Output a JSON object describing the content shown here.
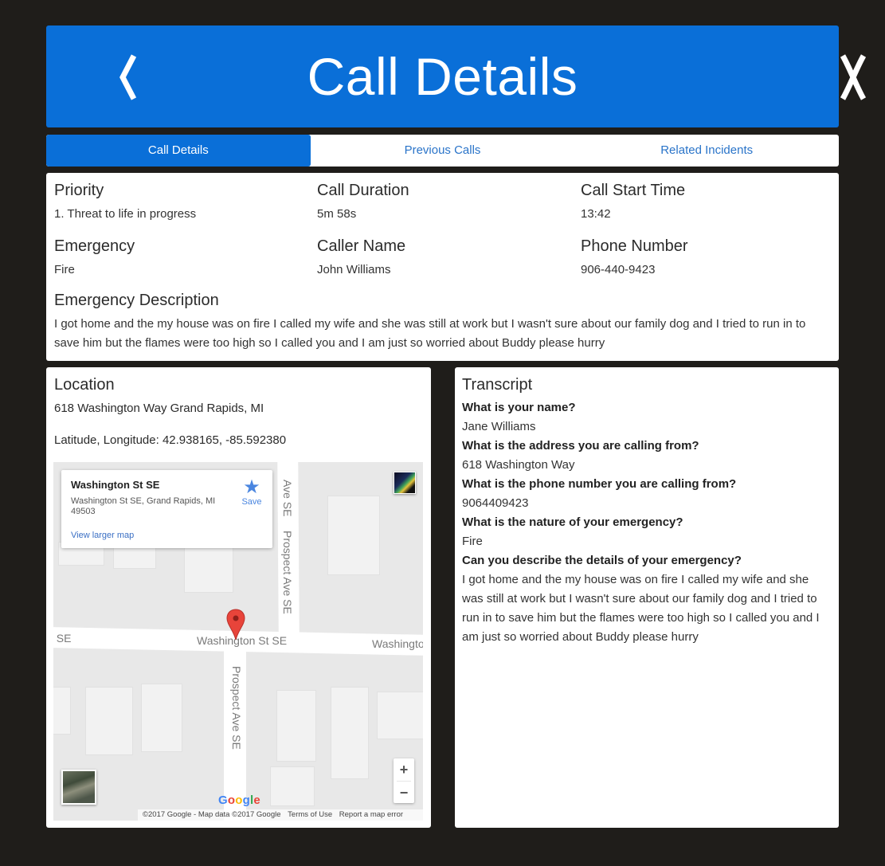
{
  "header": {
    "title": "Call Details",
    "back_icon": "chevron-left-icon",
    "close_icon": "close-icon"
  },
  "tabs": [
    {
      "label": "Call Details",
      "active": true
    },
    {
      "label": "Previous Calls",
      "active": false
    },
    {
      "label": "Related Incidents",
      "active": false
    }
  ],
  "details": {
    "priority": {
      "label": "Priority",
      "value": "1. Threat to life in progress"
    },
    "call_duration": {
      "label": "Call Duration",
      "value": "5m 58s"
    },
    "call_start_time": {
      "label": "Call Start Time",
      "value": "13:42"
    },
    "emergency": {
      "label": "Emergency",
      "value": "Fire"
    },
    "caller_name": {
      "label": "Caller Name",
      "value": "John Williams"
    },
    "phone_number": {
      "label": "Phone Number",
      "value": "906-440-9423"
    },
    "description": {
      "label": "Emergency Description",
      "value": "I got home and the my house was on fire I called my wife and she was still at work but I wasn't sure about our family dog and I tried to run in to save him but the flames were too high so I called you and I am just so worried about Buddy please hurry"
    }
  },
  "location": {
    "label": "Location",
    "address": "618 Washington Way Grand Rapids, MI",
    "coords": "Latitude, Longitude: 42.938165, -85.592380",
    "map": {
      "card_name": "Washington St SE",
      "card_address": "Washington St SE, Grand Rapids, MI 49503",
      "card_link": "View larger map",
      "save_label": "Save",
      "street_main": "Washington St SE",
      "street_left": "t SE",
      "street_right": "Washingto",
      "street_vertical_top": "Prospect Ave SE",
      "street_vertical_top_short": "Ave SE",
      "street_vertical_bottom": "Prospect Ave SE",
      "zoom_in": "+",
      "zoom_out": "−",
      "logo": "Google",
      "attribution": "©2017 Google - Map data ©2017 Google",
      "terms": "Terms of Use",
      "report": "Report a map error"
    }
  },
  "transcript": {
    "label": "Transcript",
    "items": [
      {
        "q": "What is your name?",
        "a": "Jane Williams"
      },
      {
        "q": "What is the address you are calling from?",
        "a": "618 Washington Way"
      },
      {
        "q": "What is the phone number you are calling from?",
        "a": "9064409423"
      },
      {
        "q": "What is the nature of your emergency?",
        "a": "Fire"
      },
      {
        "q": "Can you describe the details of your emergency?",
        "a": "I got home and the my house was on fire I called my wife and she was still at work but I wasn't sure about our family dog and I tried to run in to save him but the flames were too high so I called you and I am just so worried about Buddy please hurry"
      }
    ]
  },
  "colors": {
    "accent": "#0a6fd8",
    "background": "#1f1d1a",
    "panel": "#ffffff",
    "link": "#2a74c9",
    "pin": "#e8443a"
  }
}
